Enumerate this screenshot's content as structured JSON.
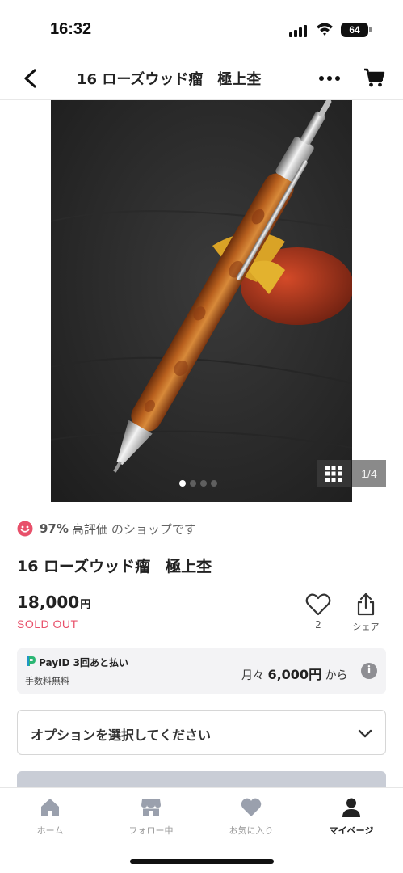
{
  "status_bar": {
    "time": "16:32",
    "battery": "64"
  },
  "header": {
    "title": "16 ローズウッド瘤　極上杢"
  },
  "gallery": {
    "page_indicator": "1/4",
    "dot_count": 4,
    "active_dot": 0
  },
  "shop_rating": {
    "percent": "97%",
    "label": "高評価",
    "suffix": "のショップです"
  },
  "product": {
    "name": "16 ローズウッド瘤　極上杢",
    "price": "18,000",
    "price_unit": "円",
    "status": "SOLD OUT",
    "favorite_count": "2",
    "share_label": "シェア"
  },
  "payid": {
    "title": "PayID 3回あと払い",
    "fee_label": "手数料無料",
    "monthly_prefix": "月々",
    "monthly_amount": "6,000円",
    "monthly_suffix": "から"
  },
  "option_select": {
    "label": "オプションを選択してください"
  },
  "tab_bar": {
    "tabs": [
      {
        "label": "ホーム",
        "icon": "home-icon"
      },
      {
        "label": "フォロー中",
        "icon": "shop-icon"
      },
      {
        "label": "お気に入り",
        "icon": "heart-icon"
      },
      {
        "label": "マイページ",
        "icon": "person-icon"
      }
    ],
    "active_index": 3
  },
  "colors": {
    "sold_out": "#e8506a",
    "smile": "#e8506a",
    "payid_green": "#2bb673",
    "tab_inactive": "#9aa0ad",
    "tab_active": "#222222"
  }
}
